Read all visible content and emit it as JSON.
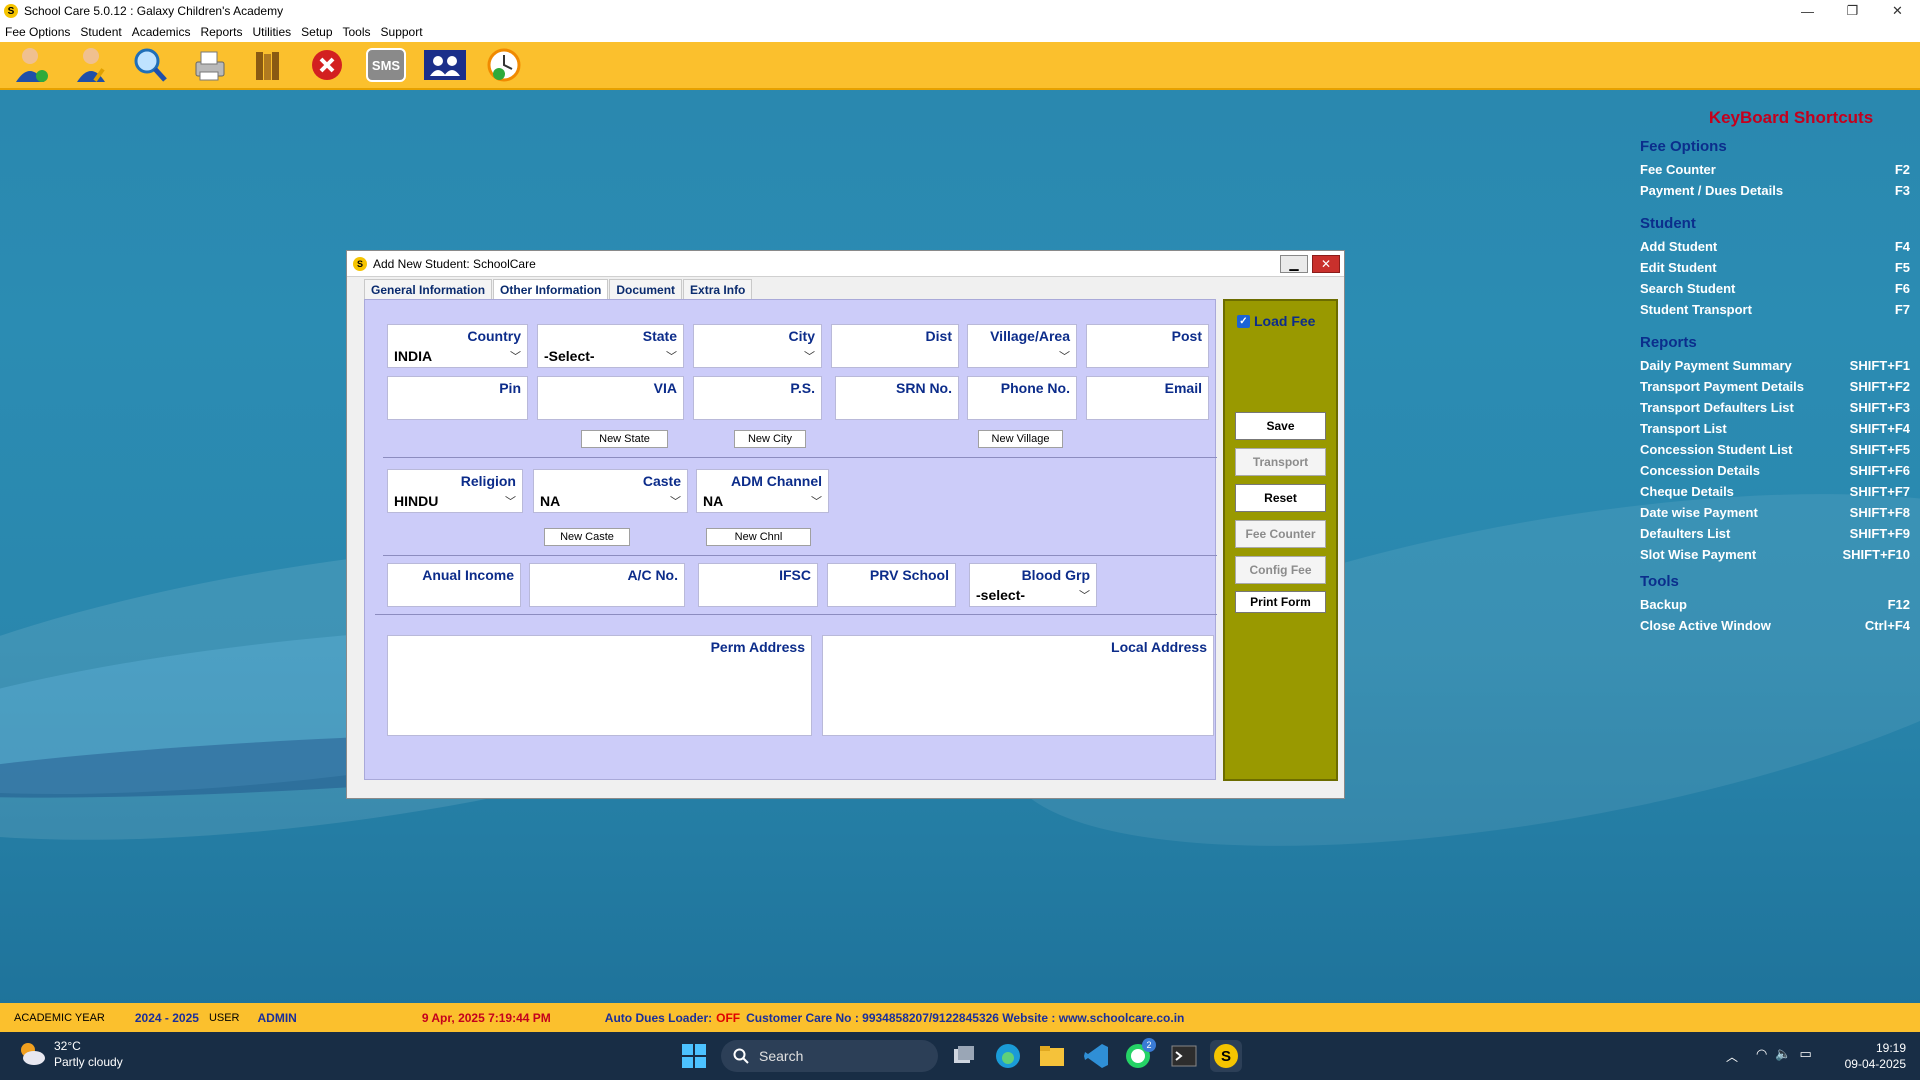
{
  "app": {
    "title": "School Care 5.0.12 : Galaxy Children's Academy",
    "icon_letter": "S"
  },
  "window_controls": [
    "—",
    "❐",
    "✕"
  ],
  "menu": [
    "Fee Options",
    "Student",
    "Academics",
    "Reports",
    "Utilities",
    "Setup",
    "Tools",
    "Support"
  ],
  "toolbar": {
    "sms_label": "SMS"
  },
  "shortcuts": {
    "title": "KeyBoard Shortcuts",
    "sections": [
      {
        "name": "Fee Options",
        "items": [
          [
            "Fee Counter",
            "F2"
          ],
          [
            "Payment / Dues Details",
            "F3"
          ]
        ]
      },
      {
        "name": "Student",
        "items": [
          [
            "Add Student",
            "F4"
          ],
          [
            "Edit Student",
            "F5"
          ],
          [
            "Search Student",
            "F6"
          ],
          [
            "Student Transport",
            "F7"
          ]
        ]
      },
      {
        "name": "Reports",
        "items": [
          [
            "Daily Payment Summary",
            "SHIFT+F1"
          ],
          [
            "Transport Payment Details",
            "SHIFT+F2"
          ],
          [
            "Transport Defaulters List",
            "SHIFT+F3"
          ],
          [
            "Transport List",
            "SHIFT+F4"
          ],
          [
            "Concession Student List",
            "SHIFT+F5"
          ],
          [
            "Concession Details",
            "SHIFT+F6"
          ],
          [
            "Cheque Details",
            "SHIFT+F7"
          ],
          [
            "Date wise Payment",
            "SHIFT+F8"
          ],
          [
            "Defaulters List",
            "SHIFT+F9"
          ],
          [
            "Slot Wise Payment",
            "SHIFT+F10"
          ]
        ]
      },
      {
        "name": "Tools",
        "items": [
          [
            "Backup",
            "F12"
          ],
          [
            "Close Active Window",
            "Ctrl+F4"
          ]
        ]
      }
    ]
  },
  "dialog": {
    "title": "Add New Student: SchoolCare",
    "icon_letter": "S",
    "tabs": [
      "General Information",
      "Other Information",
      "Document",
      "Extra Info"
    ],
    "active_tab": "Other Information",
    "fields": {
      "country": {
        "label": "Country",
        "value": "INDIA"
      },
      "state": {
        "label": "State",
        "value": "-Select-"
      },
      "city": {
        "label": "City",
        "value": ""
      },
      "dist": {
        "label": "Dist",
        "value": ""
      },
      "village": {
        "label": "Village/Area",
        "value": ""
      },
      "post": {
        "label": "Post",
        "value": ""
      },
      "pin": {
        "label": "Pin",
        "value": ""
      },
      "via": {
        "label": "VIA",
        "value": ""
      },
      "ps": {
        "label": "P.S.",
        "value": ""
      },
      "srn": {
        "label": "SRN No.",
        "value": ""
      },
      "phone": {
        "label": "Phone No.",
        "value": ""
      },
      "email": {
        "label": "Email",
        "value": ""
      },
      "religion": {
        "label": "Religion",
        "value": "HINDU"
      },
      "caste": {
        "label": "Caste",
        "value": "NA"
      },
      "adm_channel": {
        "label": "ADM Channel",
        "value": "NA"
      },
      "income": {
        "label": "Anual Income",
        "value": ""
      },
      "ac_no": {
        "label": "A/C No.",
        "value": ""
      },
      "ifsc": {
        "label": "IFSC",
        "value": ""
      },
      "prv_school": {
        "label": "PRV School",
        "value": ""
      },
      "blood": {
        "label": "Blood Grp",
        "value": "-select-"
      },
      "perm_address": {
        "label": "Perm Address",
        "value": ""
      },
      "local_address": {
        "label": "Local Address",
        "value": ""
      }
    },
    "small_buttons": {
      "new_state": "New State",
      "new_city": "New City",
      "new_village": "New Village",
      "new_caste": "New Caste",
      "new_chnl": "New Chnl"
    },
    "side": {
      "load_fee": "Load Fee",
      "load_fee_checked": true,
      "save": "Save",
      "transport": "Transport",
      "reset": "Reset",
      "fee_counter": "Fee Counter",
      "config_fee": "Config Fee",
      "print_form": "Print Form"
    }
  },
  "status": {
    "academic_year_label": "ACADEMIC YEAR",
    "academic_year": "2024 - 2025",
    "user_label": "USER",
    "user": "ADMIN",
    "datetime": "9 Apr, 2025 7:19:44 PM",
    "auto_dues_label": "Auto Dues Loader:",
    "auto_dues_value": "OFF",
    "customer_care": "Customer Care No : 9934858207/9122845326 Website : www.schoolcare.co.in"
  },
  "taskbar": {
    "weather_temp": "32°C",
    "weather_desc": "Partly cloudy",
    "search_placeholder": "Search",
    "whatsapp_badge": "2",
    "time": "19:19",
    "date": "09-04-2025"
  }
}
